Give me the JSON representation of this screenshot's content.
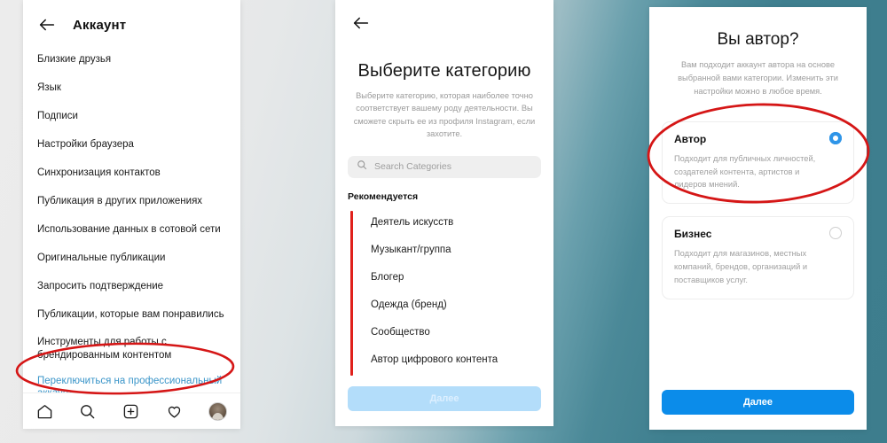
{
  "background": {
    "gradient_from": "#ececec",
    "gradient_to": "#3d7d8d"
  },
  "accent": {
    "red_annotation": "#d51616",
    "link_blue": "#3a95c9",
    "button_blue": "#0b8cea",
    "button_blue_disabled": "#b3ddfa",
    "category_bar_red": "#e0201b"
  },
  "panel1": {
    "back_icon": "arrow-left-icon",
    "title": "Аккаунт",
    "items": [
      "Близкие друзья",
      "Язык",
      "Подписи",
      "Настройки браузера",
      "Синхронизация контактов",
      "Публикация в других приложениях",
      "Использование данных в сотовой сети",
      "Оригинальные публикации",
      "Запросить подтверждение",
      "Публикации, которые вам понравились",
      "Инструменты для работы с\nбрендированным контентом"
    ],
    "highlighted_link": "Переключиться на профессиональный\nаккаунт",
    "tabbar": [
      "home-icon",
      "search-icon",
      "add-post-icon",
      "heart-icon",
      "profile-avatar"
    ]
  },
  "panel2": {
    "back_icon": "arrow-left-icon",
    "title": "Выберите категорию",
    "subtitle": "Выберите категорию, которая наиболее точно соответствует вашему роду деятельности. Вы сможете скрыть ее из профиля Instagram, если захотите.",
    "search": {
      "icon": "search-icon",
      "placeholder": "Search Categories",
      "value": ""
    },
    "section_label": "Рекомендуется",
    "categories": [
      "Деятель искусств",
      "Музыкант/группа",
      "Блогер",
      "Одежда (бренд)",
      "Сообщество",
      "Автор цифрового контента"
    ],
    "next_button": "Далее"
  },
  "panel3": {
    "title": "Вы автор?",
    "subtitle": "Вам подходит аккаунт автора на основе выбранной вами категории. Изменить эти настройки можно в любое время.",
    "options": [
      {
        "title": "Автор",
        "desc": "Подходит для публичных личностей, создателей контента, артистов и лидеров мнений.",
        "selected": true
      },
      {
        "title": "Бизнес",
        "desc": "Подходит для магазинов, местных компаний, брендов, организаций и поставщиков услуг.",
        "selected": false
      }
    ],
    "next_button": "Далее"
  }
}
